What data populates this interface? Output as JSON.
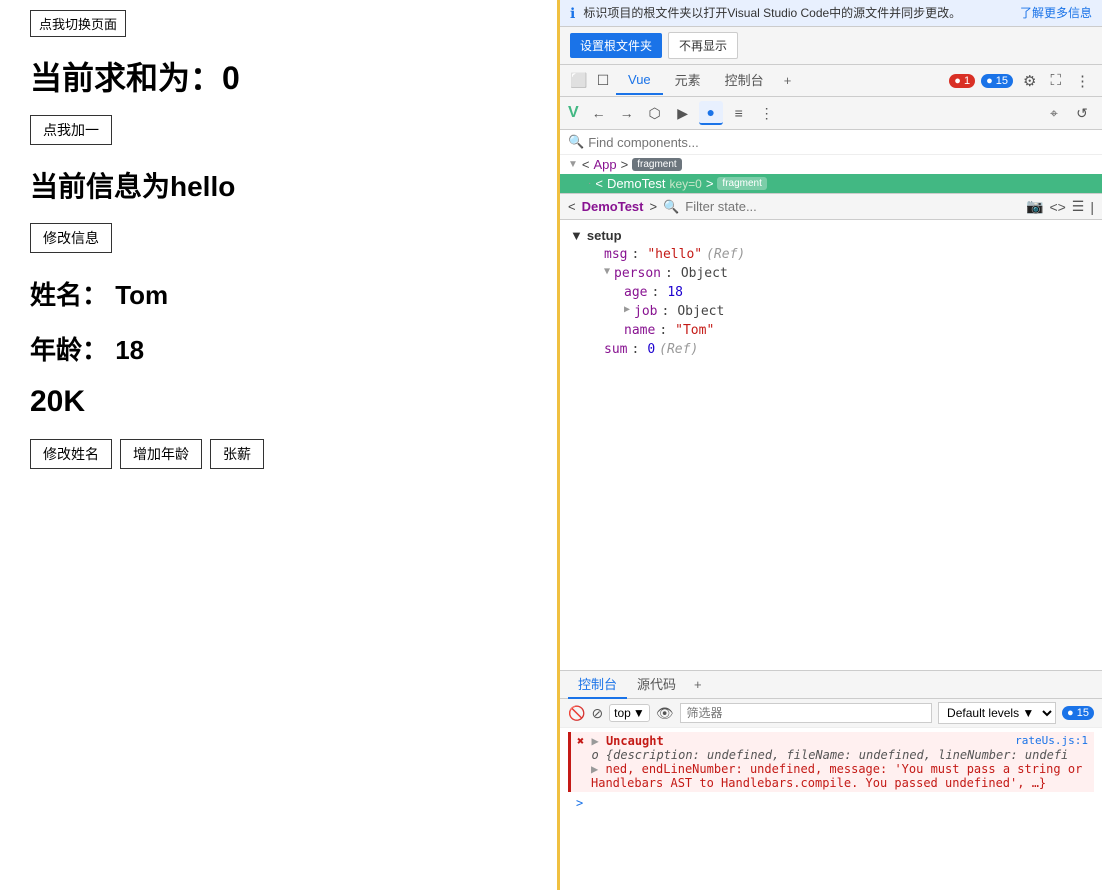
{
  "left": {
    "switch_btn": "点我切换页面",
    "sum_label": "当前求和为：0",
    "add_btn": "点我加一",
    "msg_label": "当前信息为hello",
    "modify_info_btn": "修改信息",
    "name_label": "姓名：  Tom",
    "age_label": "年龄：  18",
    "salary_label": "20K",
    "modify_name_btn": "修改姓名",
    "increase_age_btn": "增加年龄",
    "raise_salary_btn": "张薪"
  },
  "right": {
    "info_bar": {
      "text": "标识项目的根文件夹以打开Visual Studio Code中的源文件并同步更改。",
      "learn_more": "了解更多信息"
    },
    "action_bar": {
      "setup_folder": "设置根文件夹",
      "no_show": "不再显示"
    },
    "tabs": {
      "items": [
        "Vue",
        "元素",
        "控制台"
      ],
      "active": "Vue",
      "add": "+",
      "badge_red": "1",
      "badge_blue": "15"
    },
    "vue_toolbar": {
      "logo": "V",
      "btns": [
        "←",
        "→",
        "⬡",
        "▶",
        "●",
        "≡",
        "⋮",
        "⌖",
        "↺"
      ]
    },
    "component_tree": {
      "search_placeholder": "Find components...",
      "app_node": "<App>",
      "app_badge": "fragment",
      "demo_node": "·DemoTest",
      "demo_key": "key=0",
      "demo_badge": "fragment"
    },
    "inspector": {
      "comp_name": "<DemoTest>",
      "filter_placeholder": "Filter state...",
      "setup_section": "setup",
      "state": {
        "msg": "msg: \"hello\" (Ref)",
        "person": "person: Object",
        "age": "age: 18",
        "job": "job: Object",
        "name": "name: \"Tom\"",
        "sum": "sum: 0 (Ref)"
      }
    },
    "console": {
      "tabs": [
        "控制台",
        "源代码",
        "+"
      ],
      "active_tab": "控制台",
      "top_selector": "top",
      "filter_placeholder": "筛选器",
      "level_select": "Default levels",
      "badge": "15",
      "error": {
        "title": "Uncaught",
        "source": "rateUs.js:1",
        "object_text": "o {description: undefined, fileName: undefined, lineNumber: undefi",
        "detail1": "ned, endLineNumber: undefined, message: 'You must pass a string or",
        "detail2": "Handlebars AST to Handlebars.compile. You passed undefined', …}"
      }
    }
  }
}
